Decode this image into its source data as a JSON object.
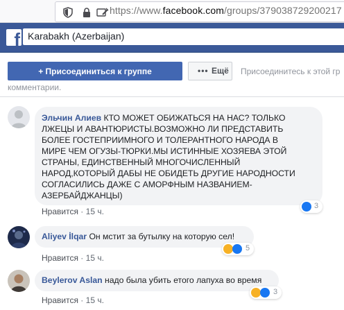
{
  "browser": {
    "url_prefix": "https://www.",
    "url_domain": "facebook.com",
    "url_path": "/groups/379038729200217"
  },
  "header": {
    "logo": "f",
    "search_value": "Karabakh (Azerbaijan)"
  },
  "group_actions": {
    "join_label": "Присоединиться к группе",
    "join_icon": "+",
    "more_dots": "•••",
    "more_label": "Ещё",
    "join_hint": "Присоединитесь к этой гр",
    "comments_word": "комментарии."
  },
  "comments": [
    {
      "author": "Эльчин Алиев",
      "lines": [
        "КТО МОЖЕТ ОБИЖАТЬСЯ НА НАС? ТОЛЬКО",
        "ЛЖЕЦЫ И АВАНТЮРИСТЫ.ВОЗМОЖНО ЛИ ПРЕДСТАВИТЬ",
        "БОЛЕЕ ГОСТЕПРИИМНОГО И ТОЛЕРАНТНОГО НАРОДА В",
        "МИРЕ ЧЕМ ОГУЗЫ-ТЮРКИ.МЫ ИСТИННЫЕ ХОЗЯЕВА ЭТОЙ",
        "СТРАНЫ, ЕДИНСТВЕННЫЙ МНОГОЧИСЛЕННЫЙ",
        "НАРОД,КОТОРЫЙ ДАБЫ НЕ ОБИДЕТЬ ДРУГИЕ НАРОДНОСТИ",
        "СОГЛАСИЛИСЬ ДАЖЕ С АМОРФНЫМ НАЗВАНИЕМ-",
        "АЗЕРБАЙДЖАНЦЫ)"
      ],
      "like_label": "Нравится",
      "separator": "·",
      "time": "15 ч.",
      "reaction_count": "3",
      "reaction_types": [
        "like"
      ]
    },
    {
      "author": "Aliyev İlqar",
      "text": "Он мстит за бутылку на которую сел!",
      "like_label": "Нравится",
      "separator": "·",
      "time": "15 ч.",
      "reaction_count": "5",
      "reaction_types": [
        "haha",
        "like"
      ]
    },
    {
      "author": "Beylerov Aslan",
      "text": "надо была убить етого лапуха во время",
      "like_label": "Нравится",
      "separator": "·",
      "time": "15 ч.",
      "reaction_count": "3",
      "reaction_types": [
        "haha",
        "like"
      ]
    }
  ],
  "colors": {
    "fb_blue": "#3b5998",
    "button_blue": "#4267b2",
    "author_link": "#385898",
    "bubble_bg": "#f2f3f5",
    "meta_gray": "#606770"
  }
}
